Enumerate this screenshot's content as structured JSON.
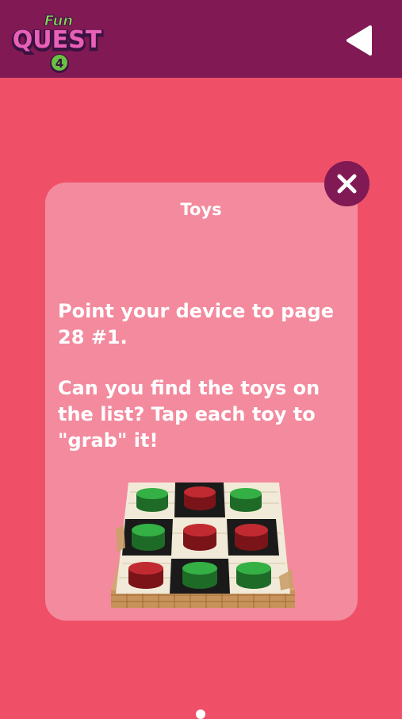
{
  "app": {
    "logo_line1": "Fun",
    "logo_line2": "QUEST",
    "logo_level": "4"
  },
  "nav": {
    "back_icon": "play-left-triangle-icon"
  },
  "modal": {
    "close_icon": "close-x-icon",
    "title": "Toys",
    "instruction_1": "Point your device to page 28 #1.",
    "instruction_2": "Can you find the toys on the list? Tap each toy to \"grab\" it!",
    "illustration": "checkers-board-with-pieces"
  },
  "colors": {
    "background": "#ef5068",
    "topbar": "#811a54",
    "card": "#f38a9e",
    "text": "#ffffff",
    "piece_green": "#2fa13d",
    "piece_red": "#b8232c"
  }
}
